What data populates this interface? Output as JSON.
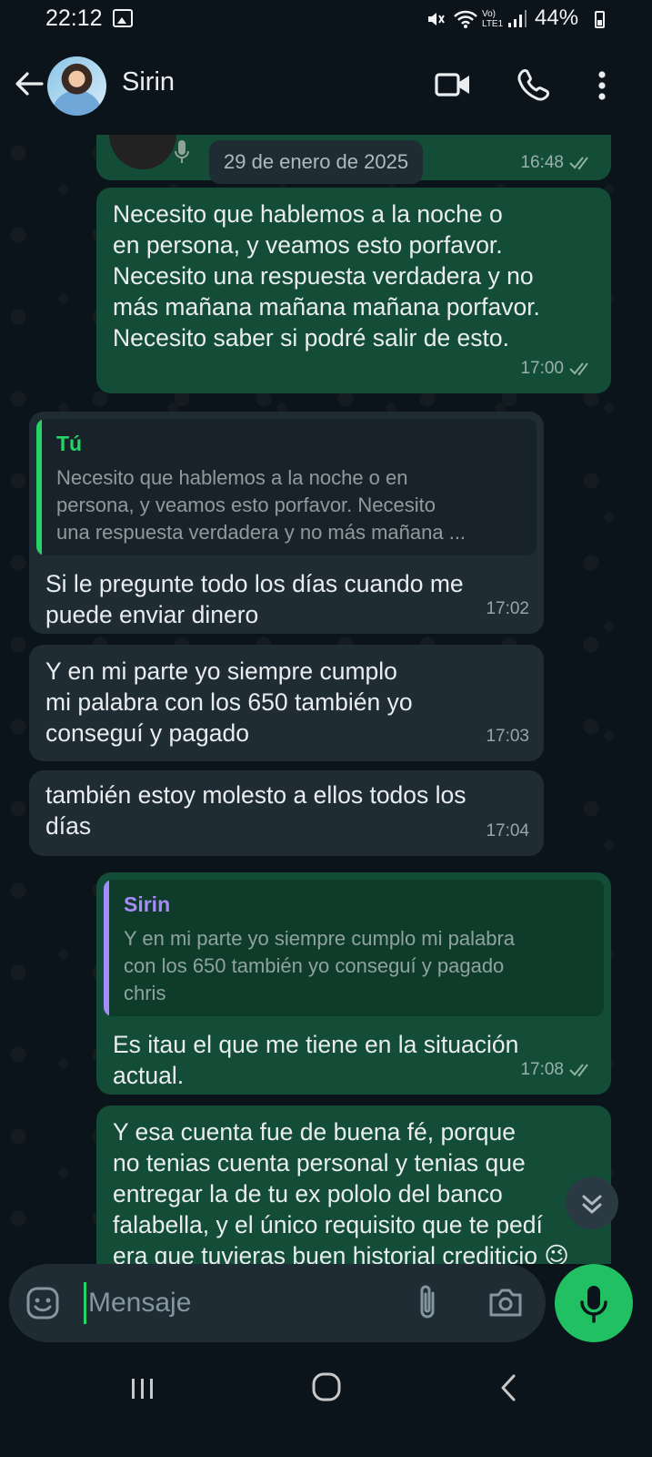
{
  "status_bar": {
    "time": "22:12",
    "network": "Vo) LTE1",
    "battery": "44%"
  },
  "header": {
    "contact_name": "Sirin"
  },
  "date_chip": "29 de enero de 2025",
  "messages": [
    {
      "direction": "out",
      "text": "Necesito que hablemos a la noche o\nen persona,  y veamos esto porfavor.\nNecesito una respuesta verdadera y no\nmás mañana mañana mañana porfavor.\nNecesito saber si podré salir de esto.",
      "time": "17:00",
      "read": true
    },
    {
      "direction": "in",
      "quote": {
        "author": "Tú",
        "text": "Necesito que hablemos a la noche o en\npersona,  y veamos esto porfavor. Necesito\nuna respuesta verdadera y no más mañana ..."
      },
      "text": "Si le pregunte todo los días cuando me\npuede enviar dinero",
      "time": "17:02"
    },
    {
      "direction": "in",
      "text": "Y en mi parte yo siempre cumplo\nmi palabra con los 650 también yo\nconseguí y pagado",
      "time": "17:03"
    },
    {
      "direction": "in",
      "text": "también estoy molesto a ellos todos los\ndías",
      "time": "17:04"
    },
    {
      "direction": "out",
      "quote": {
        "author": "Sirin",
        "text": "Y en mi parte yo siempre cumplo mi palabra\ncon los 650 también yo conseguí y pagado\nchris"
      },
      "text": "Es itau el que me tiene en la situación\nactual.",
      "time": "17:08",
      "read": true
    },
    {
      "direction": "out",
      "text": "Y esa cuenta fue de buena fé,  porque\nno tenias cuenta personal y tenias que\nentregar la de tu ex pololo del banco\nfalabella, y el único requisito que te pedí\nera que tuvieras buen historial crediticio 😉",
      "time": "",
      "read": true
    }
  ],
  "previous_message_time": "16:48",
  "input": {
    "placeholder": "Mensaje"
  },
  "icons": [
    "back-arrow-icon",
    "video-call-icon",
    "phone-icon",
    "more-icon",
    "emoji-icon",
    "attach-icon",
    "camera-icon",
    "mic-icon",
    "scroll-down-icon",
    "recents-icon",
    "home-icon",
    "back-icon"
  ],
  "colors": {
    "background": "#0b141a",
    "outgoing_bubble": "#144d37",
    "incoming_bubble": "#1f2c34",
    "accent": "#21c063",
    "quote_in_bar": "#25d366",
    "quote_out_bar": "#a78bfa"
  }
}
